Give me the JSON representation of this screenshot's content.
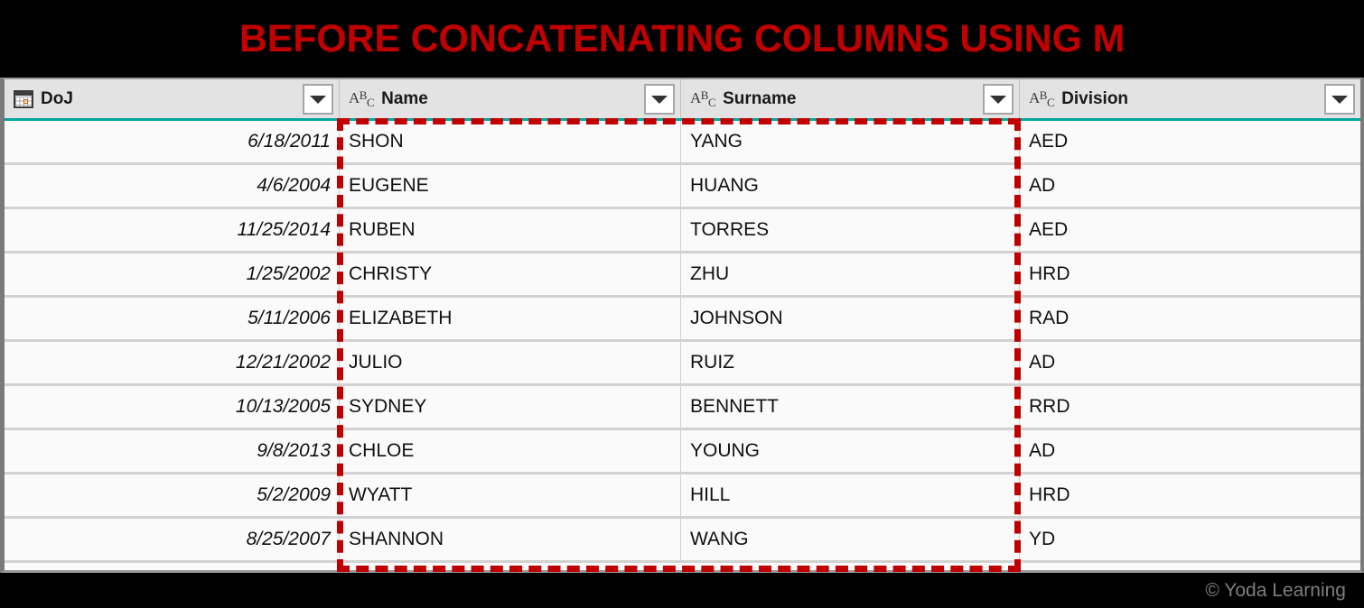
{
  "title": {
    "text": "BEFORE CONCATENATING COLUMNS USING M",
    "color": "#C00000",
    "background": "#000000"
  },
  "table": {
    "accent_color": "#00A79D",
    "header_background": "#E3E3E3",
    "row_background": "#FAFAFA",
    "columns": [
      {
        "label": "DoJ",
        "type_icon": "calendar-date-icon",
        "filter_icon": "chevron-down-icon"
      },
      {
        "label": "Name",
        "type_icon": "abc-text-icon",
        "filter_icon": "chevron-down-icon"
      },
      {
        "label": "Surname",
        "type_icon": "abc-text-icon",
        "filter_icon": "chevron-down-icon"
      },
      {
        "label": "Division",
        "type_icon": "abc-text-icon",
        "filter_icon": "chevron-down-icon"
      }
    ],
    "rows": [
      {
        "doj": "6/18/2011",
        "name": "SHON",
        "surname": "YANG",
        "division": "AED"
      },
      {
        "doj": "4/6/2004",
        "name": "EUGENE",
        "surname": "HUANG",
        "division": "AD"
      },
      {
        "doj": "11/25/2014",
        "name": "RUBEN",
        "surname": "TORRES",
        "division": "AED"
      },
      {
        "doj": "1/25/2002",
        "name": "CHRISTY",
        "surname": "ZHU",
        "division": "HRD"
      },
      {
        "doj": "5/11/2006",
        "name": "ELIZABETH",
        "surname": "JOHNSON",
        "division": "RAD"
      },
      {
        "doj": "12/21/2002",
        "name": "JULIO",
        "surname": "RUIZ",
        "division": "AD"
      },
      {
        "doj": "10/13/2005",
        "name": "SYDNEY",
        "surname": "BENNETT",
        "division": "RRD"
      },
      {
        "doj": "9/8/2013",
        "name": "CHLOE",
        "surname": "YOUNG",
        "division": "AD"
      },
      {
        "doj": "5/2/2009",
        "name": "WYATT",
        "surname": "HILL",
        "division": "HRD"
      },
      {
        "doj": "8/25/2007",
        "name": "SHANNON",
        "surname": "WANG",
        "division": "YD"
      }
    ]
  },
  "highlight": {
    "color": "#C00000",
    "style": "dashed"
  },
  "footer": {
    "watermark": "© Yoda Learning"
  }
}
